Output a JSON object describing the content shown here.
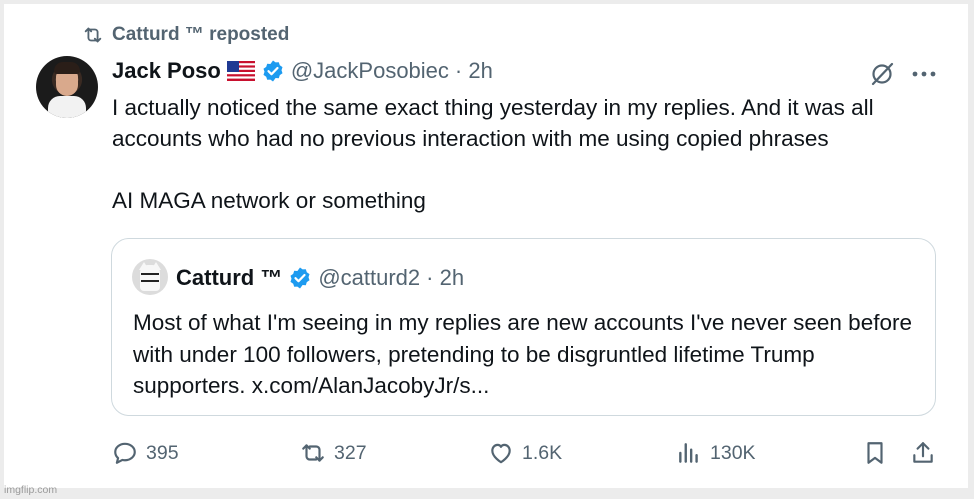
{
  "repost": {
    "label": "Catturd ™ reposted",
    "icon": "repost-icon"
  },
  "tweet": {
    "author_name": "Jack Poso",
    "flag": "us-flag-icon",
    "handle": "@JackPosobiec",
    "time": "· 2h",
    "paragraphs": [
      "I actually noticed the same exact thing yesterday in my replies. And it was all accounts who had no previous interaction with me using copied phrases",
      "AI MAGA network or something"
    ]
  },
  "quote": {
    "author_name": "Catturd ™",
    "handle": "@catturd2",
    "time": "· 2h",
    "text": "Most of what I'm seeing in my replies are new accounts I've never seen before with under 100 followers, pretending to be disgruntled lifetime Trump supporters. x.com/AlanJacobyJr/s..."
  },
  "actions": {
    "replies": "395",
    "reposts": "327",
    "likes": "1.6K",
    "views": "130K"
  },
  "watermark": "imgflip.com",
  "colors": {
    "muted": "#536471",
    "verified": "#1d9bf0",
    "border": "#cfd9de"
  }
}
